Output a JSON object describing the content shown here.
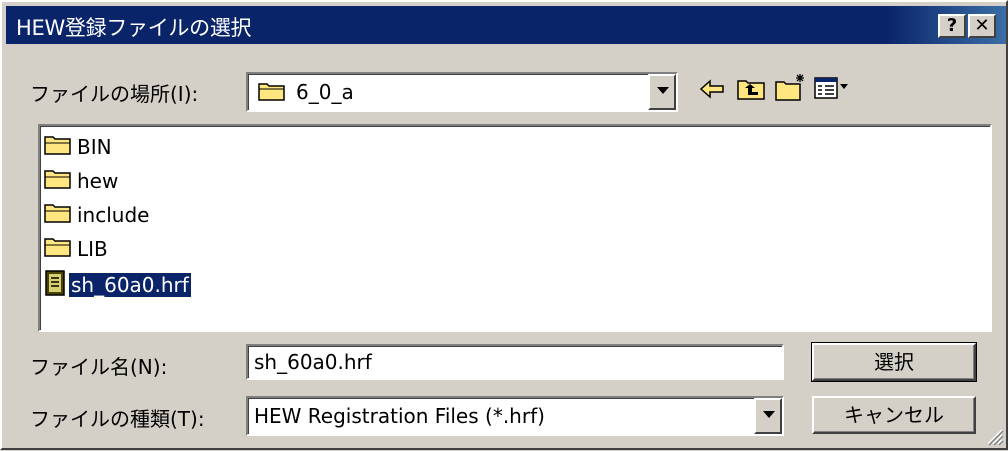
{
  "window": {
    "title": "HEW登録ファイルの選択",
    "help_label": "?",
    "close_label": "✕"
  },
  "look_in": {
    "label": "ファイルの場所(I):",
    "value": "6_0_a"
  },
  "toolbar": {
    "back_icon": "back-arrow-icon",
    "up_icon": "up-folder-icon",
    "new_folder_icon": "new-folder-icon",
    "view_icon": "view-menu-icon"
  },
  "files": [
    {
      "name": "BIN",
      "type": "folder"
    },
    {
      "name": "hew",
      "type": "folder"
    },
    {
      "name": "include",
      "type": "folder"
    },
    {
      "name": "LIB",
      "type": "folder"
    },
    {
      "name": "sh_60a0.hrf",
      "type": "file",
      "selected": true
    }
  ],
  "filename": {
    "label": "ファイル名(N):",
    "value": "sh_60a0.hrf"
  },
  "filetype": {
    "label": "ファイルの種類(T):",
    "value": "HEW Registration Files (*.hrf)"
  },
  "buttons": {
    "select": "選択",
    "cancel": "キャンセル"
  },
  "colors": {
    "titlebar": "#0a246a",
    "face": "#d4d0c8",
    "folder": "#ffe680",
    "selection": "#0a246a"
  }
}
